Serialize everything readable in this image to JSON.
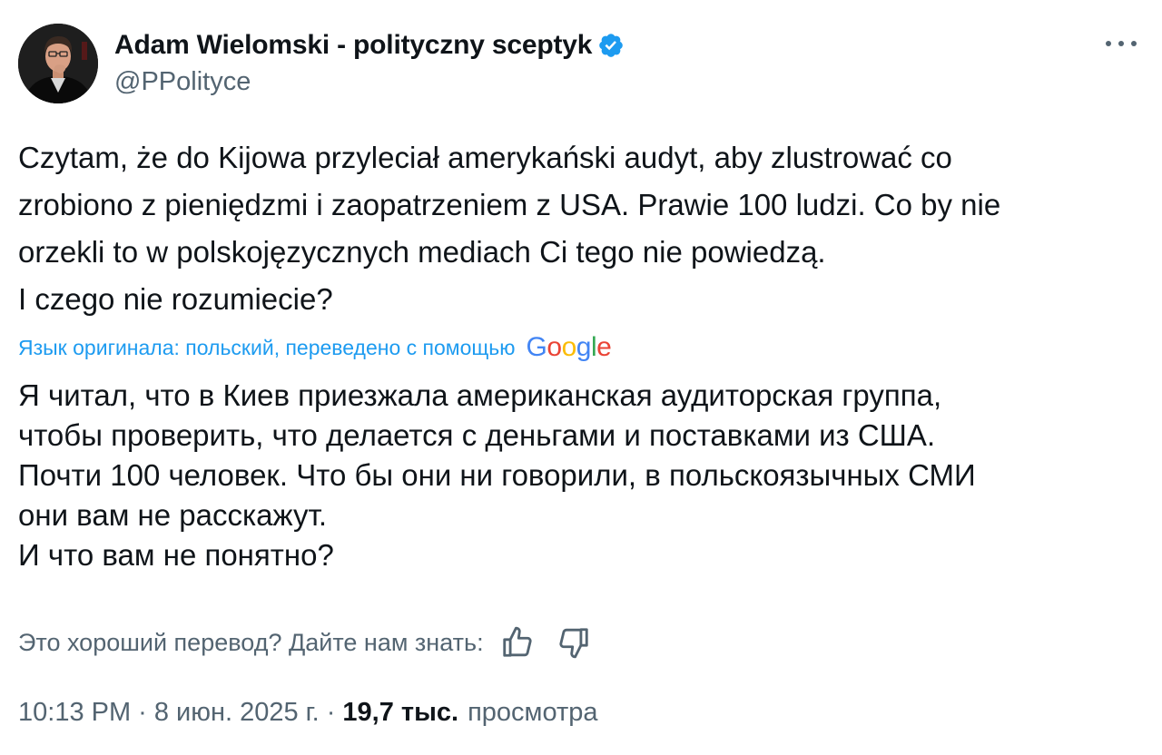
{
  "author": {
    "display_name": "Adam Wielomski - polityczny sceptyk",
    "handle": "@PPolityce",
    "verified": true,
    "verified_color": "#1d9bf0"
  },
  "tweet": {
    "lines": [
      "Czytam, że do Kijowa przyleciał amerykański audyt, aby zlustrować co",
      "zrobiono z pieniędzmi i zaopatrzeniem z USA. Prawie 100 ludzi. Co by nie",
      "orzekli to w polskojęzycznych mediach Ci tego nie powiedzą.",
      "I czego nie rozumiecie?"
    ]
  },
  "translation": {
    "label": "Язык оригинала: польский, переведено с помощью",
    "provider_letters": [
      "G",
      "o",
      "o",
      "g",
      "l",
      "e"
    ],
    "lines": [
      "Я читал, что в Киев приезжала американская аудиторская группа,",
      "чтобы проверить, что делается с деньгами и поставками из США.",
      "Почти 100 человек. Что бы они ни говорили, в польскоязычных СМИ",
      "они вам не расскажут.",
      "И что вам не понятно?"
    ],
    "feedback_prompt": "Это хороший перевод? Дайте нам знать:"
  },
  "meta": {
    "time": "10:13 PM",
    "separator": "·",
    "date": "8 июн. 2025 г.",
    "views_count": "19,7 тыс.",
    "views_label": "просмотра"
  },
  "icons": {
    "more": "more-horizontal-icon",
    "verified": "verified-badge-icon",
    "thumbs_up": "thumbs-up-icon",
    "thumbs_down": "thumbs-down-icon"
  },
  "colors": {
    "text_primary": "#0f1419",
    "text_secondary": "#536471",
    "link": "#1d9bf0",
    "background": "#ffffff"
  }
}
